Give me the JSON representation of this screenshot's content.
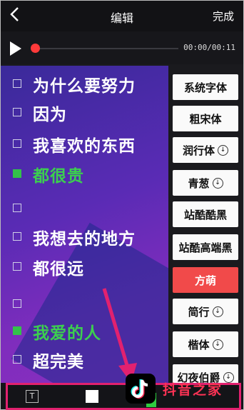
{
  "header": {
    "title": "编辑",
    "done_label": "完成",
    "back_icon": "chevron-left-icon"
  },
  "player": {
    "time": "00:00/00:11",
    "progress": 0.0,
    "play_icon": "play-icon",
    "knob_color": "#ff3a3a"
  },
  "lyrics": [
    {
      "text": "为什么要努力",
      "checked": false,
      "highlight": false
    },
    {
      "text": "因为",
      "checked": false,
      "highlight": false
    },
    {
      "text": "我喜欢的东西",
      "checked": false,
      "highlight": false
    },
    {
      "text": "都很贵",
      "checked": true,
      "highlight": true
    },
    {
      "text": "",
      "checked": false,
      "highlight": false
    },
    {
      "text": "我想去的地方",
      "checked": false,
      "highlight": false
    },
    {
      "text": "都很远",
      "checked": false,
      "highlight": false
    },
    {
      "text": "",
      "checked": false,
      "highlight": false
    },
    {
      "text": "我爱的人",
      "checked": true,
      "highlight": true
    },
    {
      "text": "超完美",
      "checked": false,
      "highlight": false
    }
  ],
  "fonts": [
    {
      "label": "系统字体",
      "download": false,
      "active": false
    },
    {
      "label": "粗宋体",
      "download": false,
      "active": false
    },
    {
      "label": "润行体",
      "download": true,
      "active": false
    },
    {
      "label": "青葱",
      "download": true,
      "active": false
    },
    {
      "label": "站酷酷黑",
      "download": false,
      "active": false
    },
    {
      "label": "站酷高端黑",
      "download": false,
      "active": false
    },
    {
      "label": "方萌",
      "download": false,
      "active": true
    },
    {
      "label": "简行",
      "download": true,
      "active": false
    },
    {
      "label": "楷体",
      "download": true,
      "active": false
    },
    {
      "label": "幻夜伯爵",
      "download": true,
      "active": false
    }
  ],
  "toolbar": {
    "text_tool_glyph": "T"
  },
  "watermark": {
    "text": "抖音之家",
    "icon": "tiktok-logo-icon"
  },
  "colors": {
    "active_font": "#f14a4a",
    "lyric_highlight": "#3ccf4f",
    "arrow": "#e2216f"
  }
}
